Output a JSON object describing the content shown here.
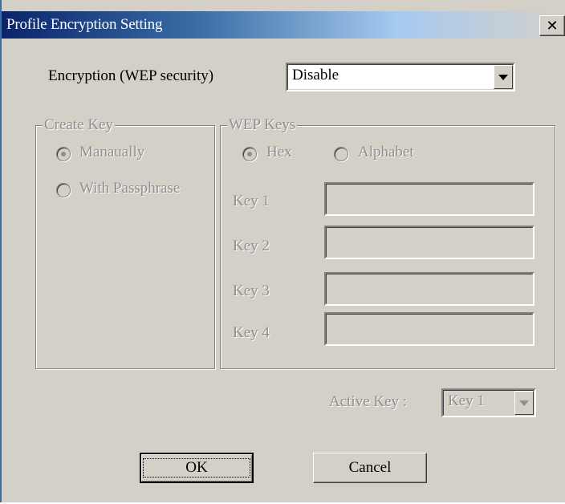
{
  "dialog": {
    "title": "Profile Encryption Setting",
    "close_glyph": "✕"
  },
  "encryption": {
    "label": "Encryption (WEP security)",
    "selected": "Disable"
  },
  "create_key": {
    "legend": "Create Key",
    "options": [
      "Manaually",
      "With Passphrase"
    ],
    "selected": "Manaually"
  },
  "wep_keys": {
    "legend": "WEP Keys",
    "formats": [
      "Hex",
      "Alphabet"
    ],
    "selected_format": "Hex",
    "keys": [
      {
        "label": "Key 1",
        "value": ""
      },
      {
        "label": "Key 2",
        "value": ""
      },
      {
        "label": "Key 3",
        "value": ""
      },
      {
        "label": "Key 4",
        "value": ""
      }
    ]
  },
  "active_key": {
    "label": "Active Key :",
    "selected": "Key 1"
  },
  "buttons": {
    "ok": "OK",
    "cancel": "Cancel"
  },
  "colors": {
    "title_active": "#0a246a",
    "face": "#d4d0c8",
    "disabled_text": "#8f8f8f"
  }
}
